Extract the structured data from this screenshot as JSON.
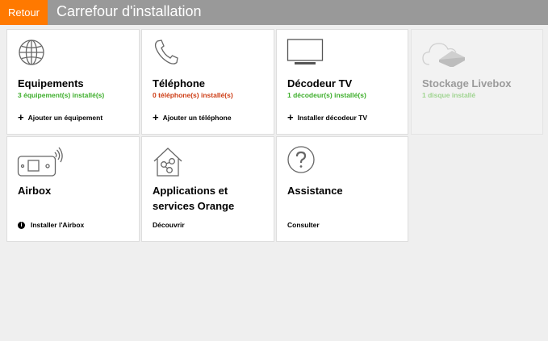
{
  "header": {
    "back_label": "Retour",
    "title": "Carrefour d'installation",
    "bar_color": "#999999",
    "back_color": "#ff7900"
  },
  "colors": {
    "status_green": "#3dae2b",
    "status_red": "#cd3c14",
    "disabled_text": "#9b9b9b"
  },
  "tiles": [
    {
      "icon": "globe-icon",
      "title": "Equipements",
      "status": "3 équipement(s) installé(s)",
      "status_color": "#3dae2b",
      "action_icon": "plus-icon",
      "action": "Ajouter un équipement"
    },
    {
      "icon": "phone-icon",
      "title": "Téléphone",
      "status": "0 téléphone(s) installé(s)",
      "status_color": "#cd3c14",
      "action_icon": "plus-icon",
      "action": "Ajouter un téléphone"
    },
    {
      "icon": "tv-icon",
      "title": "Décodeur TV",
      "status": "1 décodeur(s) installé(s)",
      "status_color": "#3dae2b",
      "action_icon": "plus-icon",
      "action": "Installer décodeur TV"
    },
    {
      "icon": "cloud-storage-icon",
      "title": "Stockage Livebox",
      "status": "1 disque installé",
      "status_color": "#9fd490",
      "disabled": true
    },
    {
      "icon": "airbox-icon",
      "title": "Airbox",
      "action_icon": "info-icon",
      "action": "Installer l'Airbox"
    },
    {
      "icon": "house-apps-icon",
      "title": "Applications et services Orange",
      "action": "Découvrir"
    },
    {
      "icon": "question-icon",
      "title": "Assistance",
      "action": "Consulter"
    }
  ]
}
